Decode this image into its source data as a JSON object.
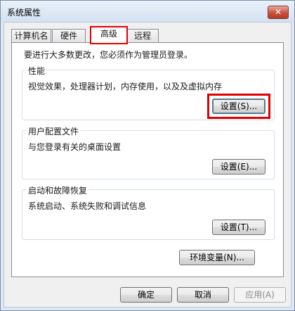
{
  "window": {
    "title": "系统属性",
    "close_glyph": "✕"
  },
  "tabs": [
    {
      "label": "计算机名"
    },
    {
      "label": "硬件"
    },
    {
      "label": "高级"
    },
    {
      "label": "远程"
    }
  ],
  "panel": {
    "notice": "要进行大多数更改，您必须作为管理员登录。",
    "performance": {
      "title": "性能",
      "desc": "视觉效果，处理器计划，内存使用，以及及虚拟内存",
      "button": "设置(S)..."
    },
    "user_profiles": {
      "title": "用户配置文件",
      "desc": "与您登录有关的桌面设置",
      "button": "设置(E)..."
    },
    "startup_recovery": {
      "title": "启动和故障恢复",
      "desc": "系统启动、系统失败和调试信息",
      "button": "设置(T)..."
    },
    "env_button": "环境变量(N)..."
  },
  "footer": {
    "ok": "确定",
    "cancel": "取消",
    "apply": "应用(A)"
  },
  "colors": {
    "highlight": "#e00000"
  }
}
